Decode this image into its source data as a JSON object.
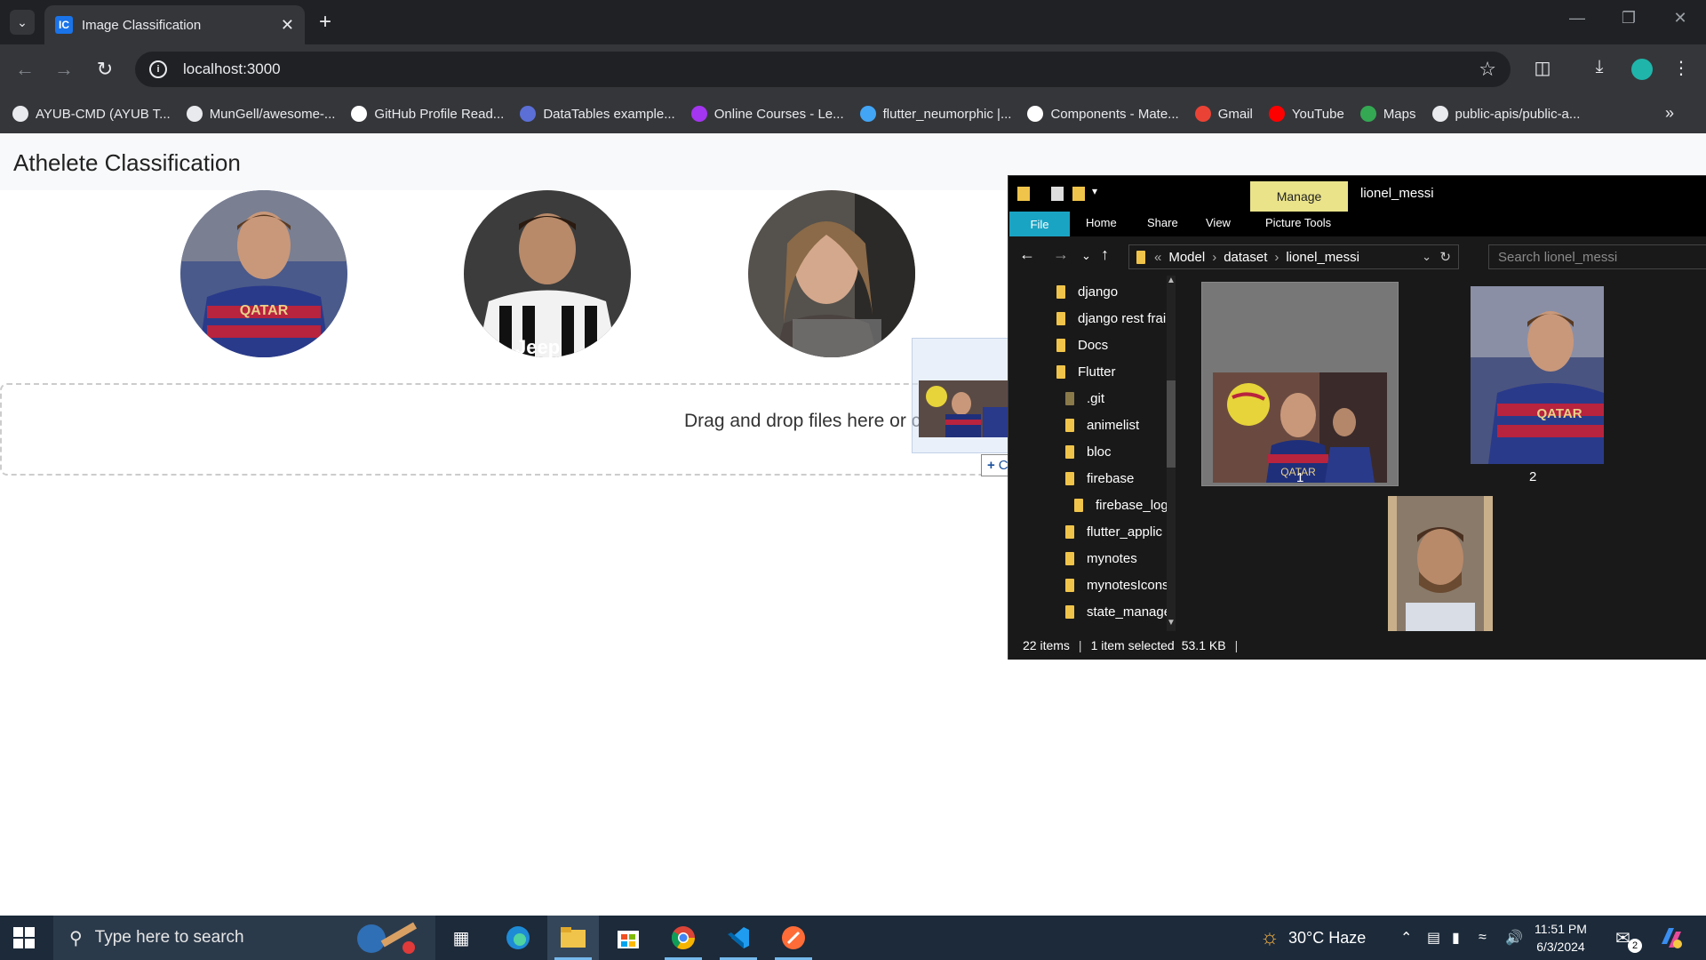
{
  "browser": {
    "tab_title": "Image Classification",
    "tab_favicon": "IC",
    "url": "localhost:3000",
    "bookmarks": [
      {
        "label": "AYUB-CMD (AYUB T...",
        "icon": "github-icon",
        "color": "#ffffff"
      },
      {
        "label": "MunGell/awesome-...",
        "icon": "github-icon",
        "color": "#ffffff"
      },
      {
        "label": "GitHub Profile Read...",
        "icon": "markdown-icon",
        "color": "#ffffff"
      },
      {
        "label": "DataTables example...",
        "icon": "datatables-icon",
        "color": "#5b6fd6"
      },
      {
        "label": "Online Courses - Le...",
        "icon": "udemy-icon",
        "color": "#a435f0"
      },
      {
        "label": "flutter_neumorphic |...",
        "icon": "flutter-icon",
        "color": "#42a5f5"
      },
      {
        "label": "Components - Mate...",
        "icon": "material-icon",
        "color": "#ffffff"
      },
      {
        "label": "Gmail",
        "icon": "gmail-icon",
        "color": "#ea4335"
      },
      {
        "label": "YouTube",
        "icon": "youtube-icon",
        "color": "#ff0000"
      },
      {
        "label": "Maps",
        "icon": "maps-icon",
        "color": "#34a853"
      },
      {
        "label": "public-apis/public-a...",
        "icon": "github-icon",
        "color": "#ffffff"
      }
    ]
  },
  "page": {
    "title": "Athelete Classification",
    "dropzone_text": "Drag and drop files here or cli",
    "drag_tooltip": "Copy"
  },
  "explorer": {
    "ribbon_manage": "Manage",
    "window_title": "lionel_messi",
    "tabs": [
      "File",
      "Home",
      "Share",
      "View",
      "Picture Tools"
    ],
    "breadcrumb": [
      "Model",
      "dataset",
      "lionel_messi"
    ],
    "search_placeholder": "Search lionel_messi",
    "tree": [
      "django",
      "django rest frai",
      "Docs",
      "Flutter",
      ".git",
      "animelist",
      "bloc",
      "firebase",
      "firebase_log",
      "flutter_applic",
      "mynotes",
      "mynotesIcons",
      "state_manage"
    ],
    "files": [
      "1",
      "2"
    ],
    "status": {
      "items": "22 items",
      "selected": "1 item selected",
      "size": "53.1 KB"
    }
  },
  "taskbar": {
    "search_placeholder": "Type here to search",
    "weather": "30°C  Haze",
    "time": "11:51 PM",
    "date": "6/3/2024",
    "notification_count": "2"
  }
}
